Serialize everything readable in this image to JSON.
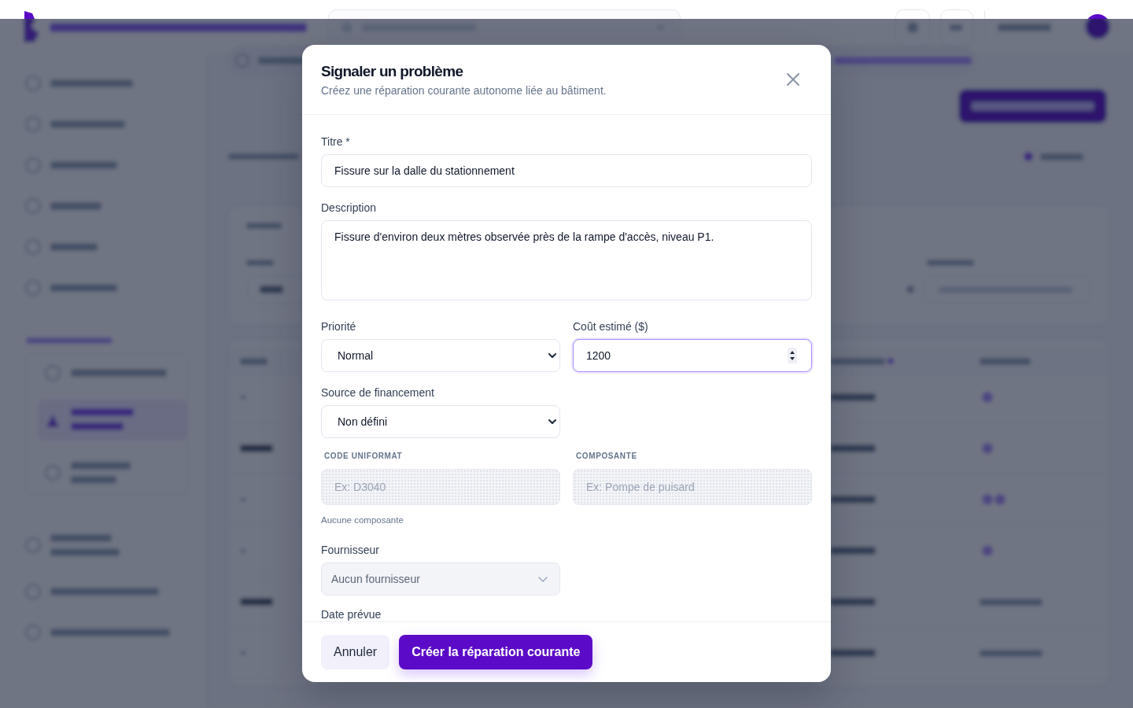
{
  "dialog": {
    "title": "Signaler un problème",
    "subtitle": "Créez une réparation courante autonome liée au bâtiment.",
    "rows": [
      {
        "kind": "standard",
        "fields": [
          {
            "kind": "text",
            "label": "Titre *",
            "value": "Fissure sur la dalle du stationnement",
            "disabled": false,
            "focused": false
          }
        ]
      },
      {
        "kind": "standard",
        "fields": [
          {
            "kind": "textarea",
            "label": "Description",
            "value": "Fissure d'environ deux mètres observée près de la rampe d'accès, niveau P1.",
            "disabled": false,
            "focused": false
          }
        ]
      },
      {
        "kind": "standard",
        "fields": [
          {
            "kind": "select",
            "label": "Priorité",
            "value": "Normal",
            "disabled": false,
            "focused": false
          },
          {
            "kind": "number",
            "label": "Coût estimé ($)",
            "value": "1200",
            "disabled": false,
            "focused": true
          }
        ]
      },
      {
        "kind": "standard",
        "fields": [
          {
            "kind": "select",
            "label": "Source de financement",
            "value": "Non défini",
            "disabled": false,
            "focused": false
          }
        ]
      },
      {
        "kind": "compact",
        "fields": [
          {
            "kind": "text",
            "label": "CODE UNIFORMAT",
            "placeholder": "Ex: D3040",
            "disabled": true,
            "focused": false
          },
          {
            "kind": "text",
            "label": "COMPOSANTE",
            "placeholder": "Ex: Pompe de puisard",
            "disabled": true,
            "focused": false
          }
        ],
        "note": "Aucune composante"
      },
      {
        "kind": "standard",
        "fields": [
          {
            "kind": "combobox",
            "label": "Fournisseur",
            "value": "Aucun fournisseur",
            "disabled": true,
            "focused": false
          }
        ]
      },
      {
        "kind": "standard",
        "fields": [
          {
            "kind": "date",
            "label": "Date prévue"
          }
        ]
      }
    ],
    "actions": [
      {
        "kind": "secondary",
        "label": "Annuler"
      },
      {
        "kind": "primary",
        "label": "Créer la réparation courante"
      }
    ]
  }
}
